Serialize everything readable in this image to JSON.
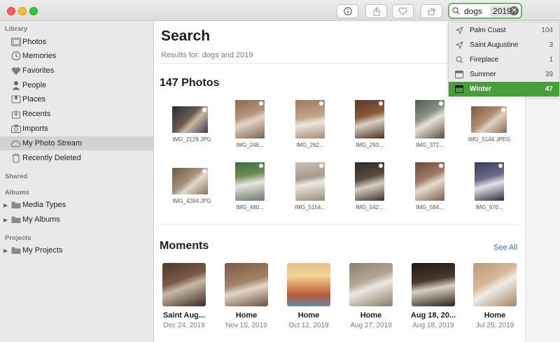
{
  "toolbar": {
    "info_icon": "info-icon",
    "share_icon": "share-icon",
    "favorite_icon": "heart-icon",
    "rotate_icon": "rotate-icon",
    "search_tokens": [
      "dogs",
      "2019"
    ]
  },
  "sidebar": {
    "library_title": "Library",
    "items": [
      {
        "label": "Photos",
        "icon": "photos-icon"
      },
      {
        "label": "Memories",
        "icon": "memories-icon"
      },
      {
        "label": "Favorites",
        "icon": "heart-icon"
      },
      {
        "label": "People",
        "icon": "person-icon"
      },
      {
        "label": "Places",
        "icon": "map-pin-icon"
      },
      {
        "label": "Recents",
        "icon": "recents-icon"
      },
      {
        "label": "Imports",
        "icon": "camera-icon"
      },
      {
        "label": "My Photo Stream",
        "icon": "cloud-icon"
      },
      {
        "label": "Recently Deleted",
        "icon": "trash-icon"
      }
    ],
    "shared_title": "Shared",
    "albums_title": "Albums",
    "albums": [
      {
        "label": "Media Types",
        "icon": "folder-icon"
      },
      {
        "label": "My Albums",
        "icon": "folder-icon"
      }
    ],
    "projects_title": "Projects",
    "projects": [
      {
        "label": "My Projects",
        "icon": "folder-icon"
      }
    ]
  },
  "main": {
    "title": "Search",
    "results": "Results for: dogs and 2019",
    "photos_heading": "147 Photos",
    "photos": [
      "IMG_2129.JPG",
      "IMG_246...",
      "IMG_262...",
      "IMG_293...",
      "IMG_372...",
      "IMG_5144.JPEG",
      "IMG_4284.JPG",
      "IMG_480...",
      "IMG_5154...",
      "IMG_542...",
      "IMG_584...",
      "IMG_670..."
    ],
    "moments_heading": "Moments",
    "see_all": "See All",
    "moments": [
      {
        "title": "Saint Aug...",
        "date": "Dec 24, 2019"
      },
      {
        "title": "Home",
        "date": "Nov 15, 2019"
      },
      {
        "title": "Home",
        "date": "Oct 12, 2019"
      },
      {
        "title": "Home",
        "date": "Aug 27, 2019"
      },
      {
        "title": "Aug 18, 20...",
        "date": "Aug 18, 2019"
      },
      {
        "title": "Home",
        "date": "Jul 25, 2019"
      }
    ]
  },
  "suggestions": [
    {
      "label": "Palm Coast",
      "count": "104",
      "icon": "location-arrow-icon"
    },
    {
      "label": "Saint Augustine",
      "count": "3",
      "icon": "location-arrow-icon"
    },
    {
      "label": "Fireplace",
      "count": "1",
      "icon": "search-icon"
    },
    {
      "label": "Summer",
      "count": "39",
      "icon": "calendar-icon"
    },
    {
      "label": "Winter",
      "count": "47",
      "icon": "calendar-icon",
      "selected": true
    }
  ],
  "colors": {
    "accent_green": "#4a9d3c",
    "link_blue": "#1a73e8",
    "sidebar_bg": "#e9e9e9"
  }
}
